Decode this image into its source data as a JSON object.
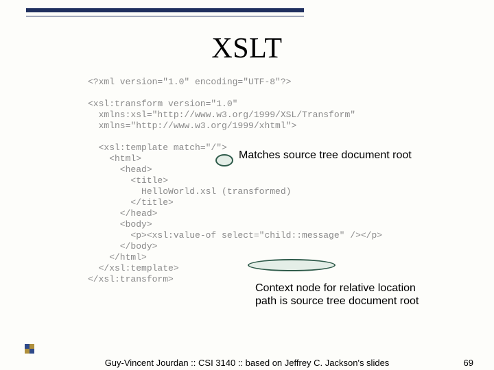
{
  "title": "XSLT",
  "code": "<?xml version=\"1.0\" encoding=\"UTF-8\"?>\n\n<xsl:transform version=\"1.0\"\n  xmlns:xsl=\"http://www.w3.org/1999/XSL/Transform\"\n  xmlns=\"http://www.w3.org/1999/xhtml\">\n\n  <xsl:template match=\"/\">\n    <html>\n      <head>\n        <title>\n          HelloWorld.xsl (transformed)\n        </title>\n      </head>\n      <body>\n        <p><xsl:value-of select=\"child::message\" /></p>\n      </body>\n    </html>\n  </xsl:template>\n</xsl:transform>",
  "callout1": "Matches source tree document root",
  "callout2_line1": "Context node for relative location",
  "callout2_line2": "path is source tree document root",
  "footer_center": "Guy-Vincent Jourdan :: CSI 3140 :: based on Jeffrey C. Jackson's slides",
  "footer_page": "69"
}
